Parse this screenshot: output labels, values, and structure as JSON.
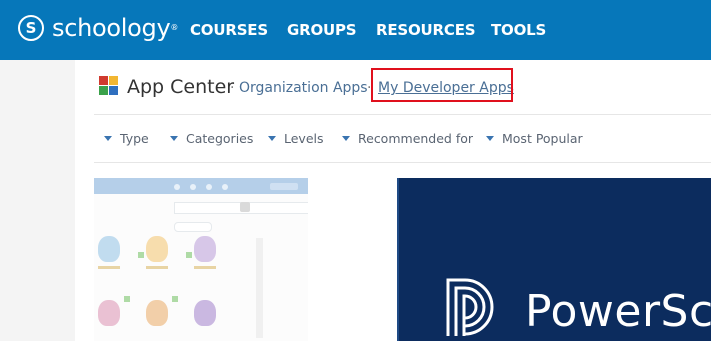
{
  "brand": {
    "logo_text": "schoology",
    "logo_mark": "S",
    "trademark": "®"
  },
  "nav": {
    "items": [
      {
        "label": "COURSES"
      },
      {
        "label": "GROUPS"
      },
      {
        "label": "RESOURCES"
      },
      {
        "label": "TOOLS"
      }
    ]
  },
  "header": {
    "title": "App Center",
    "separator": "·",
    "breadcrumbs": [
      {
        "label": "Organization Apps"
      },
      {
        "label": "My Developer Apps"
      }
    ]
  },
  "filters": [
    {
      "label": "Type"
    },
    {
      "label": "Categories"
    },
    {
      "label": "Levels"
    },
    {
      "label": "Recommended for"
    },
    {
      "label": "Most Popular"
    }
  ],
  "featured": {
    "brand_text": "PowerSc"
  },
  "colors": {
    "topbar": "#0677ba",
    "highlight": "#e0101d",
    "link": "#4a6f95",
    "banner": "#0c2c5e"
  },
  "icons": {
    "app_center": "app-center-icon",
    "filter_caret": "caret-down-icon"
  }
}
